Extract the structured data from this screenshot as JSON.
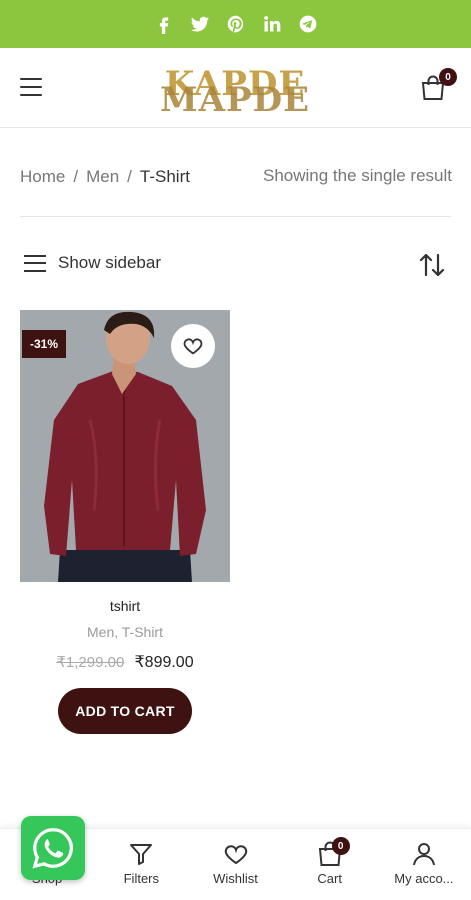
{
  "social": [
    "facebook-icon",
    "twitter-icon",
    "pinterest-icon",
    "linkedin-icon",
    "telegram-icon"
  ],
  "header": {
    "logo_line1": "KAPDE",
    "logo_line2": "MAPDE",
    "cart_count": "0"
  },
  "breadcrumb": {
    "home": "Home",
    "sep": "/",
    "men": "Men",
    "current": "T-Shirt"
  },
  "result_count": "Showing the single result",
  "tools": {
    "sidebar_label": "Show sidebar"
  },
  "product": {
    "discount": "-31%",
    "title": "tshirt",
    "categories": "Men, T-Shirt",
    "old_price": "₹1,299.00",
    "new_price": "₹899.00",
    "add_to_cart": "ADD TO CART"
  },
  "bottom_nav": {
    "shop": "Shop",
    "filters": "Filters",
    "wishlist": "Wishlist",
    "cart": "Cart",
    "cart_count": "0",
    "account": "My acco..."
  },
  "colors": {
    "topbar": "#8cc63f",
    "brand_dark": "#3d1210",
    "whatsapp": "#35c75a"
  }
}
